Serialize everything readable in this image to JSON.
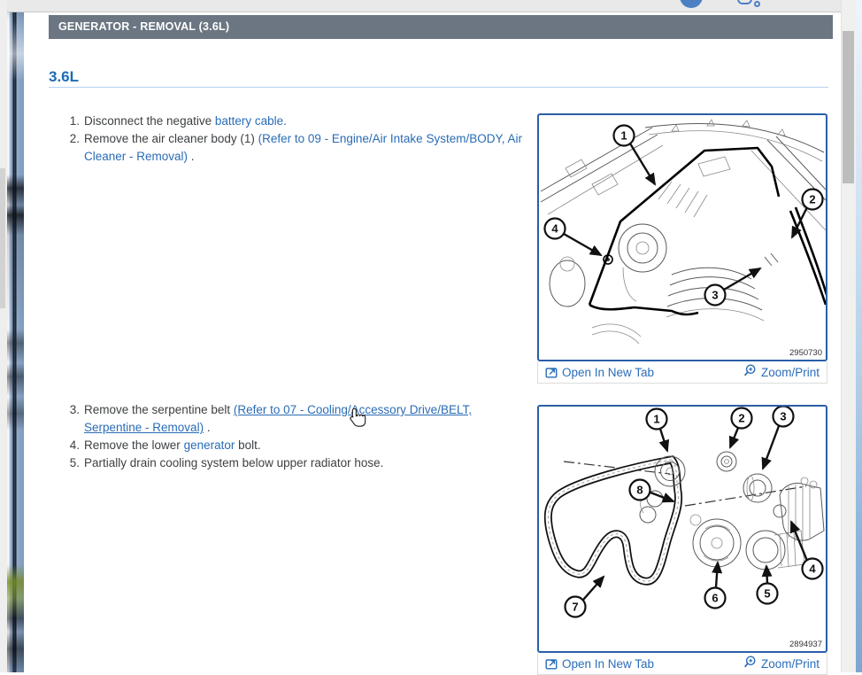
{
  "colors": {
    "link": "#2a6cb5",
    "title_bar_bg": "#6b7682",
    "heading": "#1a6cb4",
    "figure_border": "#2b5ea7"
  },
  "title_bar": {
    "title": "GENERATOR - REMOVAL (3.6L)"
  },
  "section": {
    "heading": "3.6L"
  },
  "steps": {
    "one": {
      "num": "1.",
      "text": "Disconnect the negative ",
      "link": "battery cable."
    },
    "two": {
      "num": "2.",
      "text": "Remove the air cleaner body (1) ",
      "link_line1": "(Refer to 09 - Engine/Air Intake System/BODY, Air",
      "link_line2": "Cleaner - Removal)",
      "suffix": " ."
    },
    "three": {
      "num": "3.",
      "text": "Remove the serpentine belt ",
      "link_line1": "(Refer to 07 - Cooling/Accessory Drive/BELT,",
      "link_line2": "Serpentine - Removal)",
      "suffix": " ."
    },
    "four": {
      "num": "4.",
      "text": "Remove the lower ",
      "link": "generator",
      "suffix": " bolt."
    },
    "five": {
      "num": "5.",
      "text": "Partially drain cooling system below upper radiator hose."
    }
  },
  "figure1": {
    "number": "2950730",
    "open_label": "Open In New Tab",
    "zoom_label": "Zoom/Print",
    "callouts": [
      "1",
      "2",
      "3",
      "4"
    ]
  },
  "figure2": {
    "number": "2894937",
    "open_label": "Open In New Tab",
    "zoom_label": "Zoom/Print",
    "callouts": [
      "1",
      "2",
      "3",
      "4",
      "5",
      "6",
      "7",
      "8"
    ]
  }
}
